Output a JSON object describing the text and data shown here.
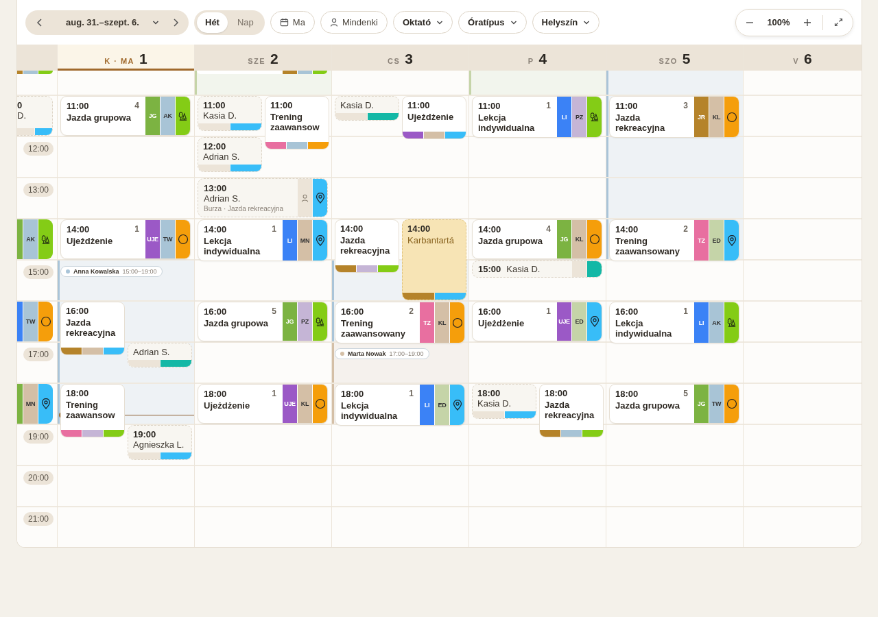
{
  "toolbar": {
    "range": "aug. 31.–szept. 6.",
    "views": [
      {
        "label": "Hét",
        "selected": true
      },
      {
        "label": "Nap",
        "selected": false
      }
    ],
    "today": "Ma",
    "filters": [
      {
        "label": "Mindenki",
        "kind": "person"
      },
      {
        "label": "Oktató",
        "kind": "dropdown"
      },
      {
        "label": "Óratípus",
        "kind": "dropdown"
      },
      {
        "label": "Helyszín",
        "kind": "dropdown"
      }
    ],
    "zoom": "100%"
  },
  "days": [
    {
      "slots": [
        {
          "events": [
            {
              "kind": "cut",
              "strip": [
                {
                  "color": "#b5832a"
                },
                {
                  "color": "#a8c4d6"
                },
                {
                  "color": "#84cc16"
                }
              ]
            }
          ]
        },
        {
          "events": [
            {
              "kind": "clipped-private",
              "time": "0",
              "name": "D.",
              "strip": [
                {
                  "color": "#ece4d8"
                },
                {
                  "color": "#38bdf8"
                }
              ]
            }
          ]
        },
        {
          "time_label": "12:00"
        },
        {
          "time_label": "13:00"
        },
        {
          "events": [
            {
              "kind": "clipped-lesson",
              "tags": [
                {
                  "kind": "blank",
                  "color": "#7cb342"
                },
                {
                  "kind": "code",
                  "text": "AK",
                  "color": "#a8c4d6"
                },
                {
                  "kind": "trees",
                  "color": "#84cc16"
                }
              ]
            }
          ]
        },
        {
          "time_label": "15:00"
        },
        {
          "events": [
            {
              "kind": "clipped-lesson",
              "tags": [
                {
                  "kind": "blank",
                  "color": "#3b82f6"
                },
                {
                  "kind": "code",
                  "text": "TW",
                  "color": "#a8c4d6"
                },
                {
                  "kind": "ring",
                  "color": "#f59e0b"
                }
              ]
            }
          ]
        },
        {
          "time_label": "17:00"
        },
        {
          "events": [
            {
              "kind": "clipped-lesson",
              "tags": [
                {
                  "kind": "blank",
                  "color": "#7cb342"
                },
                {
                  "kind": "code",
                  "text": "MN",
                  "color": "#d4bfa6"
                },
                {
                  "kind": "pin",
                  "color": "#38bdf8"
                }
              ]
            }
          ]
        },
        {
          "time_label": "19:00"
        },
        {
          "time_label": "20:00"
        },
        {
          "time_label": "21:00"
        }
      ]
    },
    {
      "weekday": "K · MA",
      "number": "1",
      "today": true,
      "slots": [
        {
          "shaded": false
        },
        {
          "events": [
            {
              "kind": "lesson",
              "time": "11:00",
              "count": "4",
              "title": "Jazda grupowa",
              "tags": [
                {
                  "kind": "code",
                  "text": "JG",
                  "color": "#7cb342"
                },
                {
                  "kind": "code",
                  "text": "AK",
                  "color": "#a8c4d6"
                },
                {
                  "kind": "trees",
                  "color": "#84cc16"
                }
              ]
            }
          ]
        },
        {
          "shaded": false
        },
        {
          "shaded": false
        },
        {
          "events": [
            {
              "kind": "lesson",
              "time": "14:00",
              "count": "1",
              "title": "Ujeżdżenie",
              "tags": [
                {
                  "kind": "code",
                  "text": "UJE",
                  "color": "#9b59c6"
                },
                {
                  "kind": "code",
                  "text": "TW",
                  "color": "#a8c4d6"
                },
                {
                  "kind": "ring",
                  "color": "#f59e0b"
                }
              ]
            }
          ]
        },
        {
          "shaded": true,
          "color": "#a9c4d8",
          "events": [
            {
              "kind": "person",
              "name": "Anna Kowalska",
              "time": "15:00–19:00",
              "color": "#a9c4d8"
            }
          ]
        },
        {
          "shaded": true,
          "color": "#a9c4d8",
          "events": [
            {
              "kind": "group",
              "time": "16:00",
              "title": "Jazda rekreacyjna",
              "strip": [
                {
                  "color": "#b5832a"
                },
                {
                  "color": "#d4bfa6"
                },
                {
                  "color": "#38bdf8"
                }
              ]
            }
          ]
        },
        {
          "shaded": true,
          "color": "#a9c4d8",
          "events": [
            {
              "kind": "private",
              "name": "Adrian S.",
              "strip": [
                {
                  "color": "#ece4d8"
                },
                {
                  "color": "#14b8a6"
                }
              ]
            }
          ]
        },
        {
          "shaded": true,
          "color": "#a9c4d8",
          "now": true,
          "events": [
            {
              "kind": "group",
              "time": "18:00",
              "title": "Trening zaawansow",
              "strip": [
                {
                  "color": "#e86fa0"
                },
                {
                  "color": "#c5b5d6"
                },
                {
                  "color": "#84cc16"
                }
              ]
            }
          ]
        },
        {
          "events": [
            {
              "kind": "private",
              "time": "19:00",
              "name": "Agnieszka L.",
              "strip": [
                {
                  "color": "#ece4d8"
                },
                {
                  "color": "#38bdf8"
                }
              ]
            }
          ]
        }
      ]
    },
    {
      "weekday": "SZE",
      "number": "2",
      "today": false,
      "slots": [
        {
          "shaded": true,
          "color": "#c5d4a8",
          "events": [
            {
              "kind": "cut",
              "strip": [
                {
                  "color": "#b5832a"
                },
                {
                  "color": "#a8c4d6"
                },
                {
                  "color": "#84cc16"
                }
              ]
            }
          ]
        },
        {
          "events": [
            {
              "kind": "private",
              "time": "11:00",
              "name": "Kasia D.",
              "strip": [
                {
                  "color": "#ece4d8"
                },
                {
                  "color": "#38bdf8"
                }
              ]
            },
            {
              "kind": "group",
              "time": "11:00",
              "title": "Trening zaawansow",
              "strip": [
                {
                  "color": "#e86fa0"
                },
                {
                  "color": "#a8c4d6"
                },
                {
                  "color": "#f59e0b"
                }
              ]
            }
          ]
        },
        {
          "events": [
            {
              "kind": "private",
              "time": "12:00",
              "name": "Adrian S.",
              "strip": [
                {
                  "color": "#ece4d8"
                },
                {
                  "color": "#38bdf8"
                }
              ]
            }
          ]
        },
        {
          "events": [
            {
              "kind": "private-wide",
              "time": "13:00",
              "name": "Adrian S.",
              "subtitle": "Burza · Jazda rekreacyjna",
              "tags": [
                {
                  "kind": "person",
                  "color": "#ece4d8"
                },
                {
                  "kind": "pin",
                  "color": "#38bdf8"
                }
              ]
            }
          ]
        },
        {
          "events": [
            {
              "kind": "lesson",
              "time": "14:00",
              "count": "1",
              "title": "Lekcja indywidualna",
              "tags": [
                {
                  "kind": "code",
                  "text": "LI",
                  "color": "#3b82f6"
                },
                {
                  "kind": "code",
                  "text": "MN",
                  "color": "#d4bfa6"
                },
                {
                  "kind": "pin",
                  "color": "#38bdf8"
                }
              ]
            }
          ]
        },
        {
          "shaded": false
        },
        {
          "events": [
            {
              "kind": "lesson",
              "time": "16:00",
              "count": "5",
              "title": "Jazda grupowa",
              "tags": [
                {
                  "kind": "code",
                  "text": "JG",
                  "color": "#7cb342"
                },
                {
                  "kind": "code",
                  "text": "PZ",
                  "color": "#c5b5d6"
                },
                {
                  "kind": "trees",
                  "color": "#84cc16"
                }
              ]
            }
          ]
        },
        {
          "shaded": false
        },
        {
          "events": [
            {
              "kind": "lesson",
              "time": "18:00",
              "count": "1",
              "title": "Ujeżdżenie",
              "tags": [
                {
                  "kind": "code",
                  "text": "UJE",
                  "color": "#9b59c6"
                },
                {
                  "kind": "code",
                  "text": "KL",
                  "color": "#d4bfa6"
                },
                {
                  "kind": "ring",
                  "color": "#f59e0b"
                }
              ]
            }
          ]
        }
      ]
    },
    {
      "weekday": "CS",
      "number": "3",
      "today": false,
      "slots": [
        {
          "shaded": false
        },
        {
          "events": [
            {
              "kind": "private",
              "name": "Kasia D.",
              "strip": [
                {
                  "color": "#ece4d8"
                },
                {
                  "color": "#14b8a6"
                }
              ]
            },
            {
              "kind": "group",
              "time": "11:00",
              "title": "Ujeżdżenie",
              "strip": [
                {
                  "color": "#9b59c6"
                },
                {
                  "color": "#d4bfa6"
                },
                {
                  "color": "#38bdf8"
                }
              ]
            }
          ]
        },
        {
          "shaded": false
        },
        {
          "shaded": false
        },
        {
          "events": [
            {
              "kind": "group",
              "time": "14:00",
              "title": "Jazda rekreacyjna",
              "strip": [
                {
                  "color": "#b5832a"
                },
                {
                  "color": "#c5b5d6"
                },
                {
                  "color": "#84cc16"
                }
              ]
            },
            {
              "kind": "maintenance",
              "time": "14:00",
              "title": "Karbantartá",
              "strip": [
                {
                  "color": "#b5832a"
                },
                {
                  "color": "#38bdf8"
                }
              ]
            }
          ]
        },
        {
          "shaded": true,
          "color": "#a9c4d8"
        },
        {
          "shaded": true,
          "color": "#a9c4d8",
          "events": [
            {
              "kind": "lesson",
              "time": "16:00",
              "count": "2",
              "title": "Trening zaawansowany",
              "tags": [
                {
                  "kind": "code",
                  "text": "TZ",
                  "color": "#e86fa0"
                },
                {
                  "kind": "code",
                  "text": "KL",
                  "color": "#d4bfa6"
                },
                {
                  "kind": "ring",
                  "color": "#f59e0b"
                }
              ]
            }
          ]
        },
        {
          "shaded": true,
          "color": "#d4bfa6",
          "events": [
            {
              "kind": "person",
              "name": "Marta Nowak",
              "time": "17:00–19:00",
              "color": "#d4bfa6"
            }
          ]
        },
        {
          "shaded": true,
          "color": "#d4bfa6",
          "events": [
            {
              "kind": "lesson",
              "time": "18:00",
              "count": "1",
              "title": "Lekcja indywidualna",
              "tags": [
                {
                  "kind": "code",
                  "text": "LI",
                  "color": "#3b82f6"
                },
                {
                  "kind": "code",
                  "text": "ED",
                  "color": "#c5d4a8"
                },
                {
                  "kind": "pin",
                  "color": "#38bdf8"
                }
              ]
            }
          ]
        }
      ]
    },
    {
      "weekday": "P",
      "number": "4",
      "today": false,
      "slots": [
        {
          "shaded": true,
          "color": "#c5d4a8"
        },
        {
          "events": [
            {
              "kind": "lesson",
              "time": "11:00",
              "count": "1",
              "title": "Lekcja indywidualna",
              "tags": [
                {
                  "kind": "code",
                  "text": "LI",
                  "color": "#3b82f6"
                },
                {
                  "kind": "code",
                  "text": "PZ",
                  "color": "#c5b5d6"
                },
                {
                  "kind": "trees",
                  "color": "#84cc16"
                }
              ]
            }
          ]
        },
        {
          "shaded": false
        },
        {
          "shaded": false
        },
        {
          "events": [
            {
              "kind": "lesson",
              "time": "14:00",
              "count": "4",
              "title": "Jazda grupowa",
              "tags": [
                {
                  "kind": "code",
                  "text": "JG",
                  "color": "#7cb342"
                },
                {
                  "kind": "code",
                  "text": "KL",
                  "color": "#d4bfa6"
                },
                {
                  "kind": "ring",
                  "color": "#f59e0b"
                }
              ]
            }
          ]
        },
        {
          "events": [
            {
              "kind": "private-wide",
              "time": "15:00",
              "name": "Kasia D.",
              "tags": [
                {
                  "kind": "blank",
                  "color": "#ece4d8"
                },
                {
                  "kind": "blank",
                  "color": "#14b8a6"
                }
              ]
            }
          ]
        },
        {
          "events": [
            {
              "kind": "lesson",
              "time": "16:00",
              "count": "1",
              "title": "Ujeżdżenie",
              "tags": [
                {
                  "kind": "code",
                  "text": "UJE",
                  "color": "#9b59c6"
                },
                {
                  "kind": "code",
                  "text": "ED",
                  "color": "#c5d4a8"
                },
                {
                  "kind": "pin",
                  "color": "#38bdf8"
                }
              ]
            }
          ]
        },
        {
          "shaded": false
        },
        {
          "events": [
            {
              "kind": "private",
              "time": "18:00",
              "name": "Kasia D.",
              "strip": [
                {
                  "color": "#ece4d8"
                },
                {
                  "color": "#38bdf8"
                }
              ]
            },
            {
              "kind": "group",
              "time": "18:00",
              "title": "Jazda rekreacyjna",
              "strip": [
                {
                  "color": "#b5832a"
                },
                {
                  "color": "#a8c4d6"
                },
                {
                  "color": "#84cc16"
                }
              ]
            }
          ]
        }
      ]
    },
    {
      "weekday": "SZO",
      "number": "5",
      "today": false,
      "slots": [
        {
          "shaded": true,
          "color": "#a9c4d8"
        },
        {
          "shaded": true,
          "color": "#a9c4d8",
          "events": [
            {
              "kind": "lesson",
              "time": "11:00",
              "count": "3",
              "title": "Jazda rekreacyjna",
              "tags": [
                {
                  "kind": "code",
                  "text": "JR",
                  "color": "#b5832a"
                },
                {
                  "kind": "code",
                  "text": "KL",
                  "color": "#d4bfa6"
                },
                {
                  "kind": "ring",
                  "color": "#f59e0b"
                }
              ]
            }
          ]
        },
        {
          "shaded": true,
          "color": "#a9c4d8"
        },
        {
          "shaded": true,
          "color": "#a9c4d8"
        },
        {
          "shaded": true,
          "color": "#a9c4d8",
          "events": [
            {
              "kind": "lesson",
              "time": "14:00",
              "count": "2",
              "title": "Trening zaawansowany",
              "tags": [
                {
                  "kind": "code",
                  "text": "TZ",
                  "color": "#e86fa0"
                },
                {
                  "kind": "code",
                  "text": "ED",
                  "color": "#c5d4a8"
                },
                {
                  "kind": "pin",
                  "color": "#38bdf8"
                }
              ]
            }
          ]
        },
        {
          "shaded": false
        },
        {
          "events": [
            {
              "kind": "lesson",
              "time": "16:00",
              "count": "1",
              "title": "Lekcja indywidualna",
              "tags": [
                {
                  "kind": "code",
                  "text": "LI",
                  "color": "#3b82f6"
                },
                {
                  "kind": "code",
                  "text": "AK",
                  "color": "#a8c4d6"
                },
                {
                  "kind": "trees",
                  "color": "#84cc16"
                }
              ]
            }
          ]
        },
        {
          "shaded": false
        },
        {
          "events": [
            {
              "kind": "lesson",
              "time": "18:00",
              "count": "5",
              "title": "Jazda grupowa",
              "tags": [
                {
                  "kind": "code",
                  "text": "JG",
                  "color": "#7cb342"
                },
                {
                  "kind": "code",
                  "text": "TW",
                  "color": "#a8c4d6"
                },
                {
                  "kind": "ring",
                  "color": "#f59e0b"
                }
              ]
            }
          ]
        }
      ]
    },
    {
      "weekday": "V",
      "number": "6",
      "today": false
    }
  ]
}
